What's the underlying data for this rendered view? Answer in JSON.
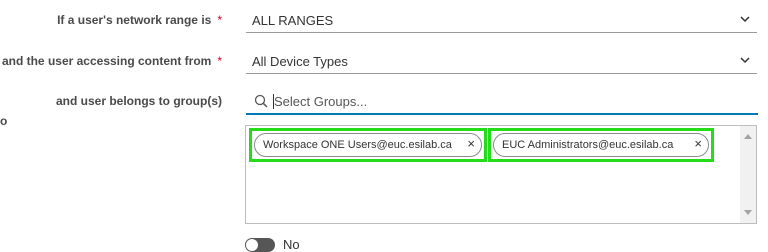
{
  "colors": {
    "required": "#d0021b",
    "focus_underline": "#0079b8",
    "highlight": "#23dd1a"
  },
  "rule": {
    "network_range": {
      "label": "If a user's network range is",
      "required_marker": "*",
      "value": "ALL RANGES",
      "icon": "chevron-down-icon"
    },
    "device_type": {
      "label": "and the user accessing content from",
      "required_marker": "*",
      "value": "All Device Types",
      "icon": "chevron-down-icon"
    },
    "groups": {
      "label": "and user belongs to group(s)",
      "search_icon": "search-icon",
      "placeholder": "Select Groups...",
      "selected": [
        {
          "label": "Workspace ONE Users@euc.esilab.ca",
          "remove": "×"
        },
        {
          "label": "EUC Administrators@euc.esilab.ca",
          "remove": "×"
        }
      ]
    },
    "cut_off_left_text": "o",
    "toggle": {
      "label": "No"
    }
  }
}
